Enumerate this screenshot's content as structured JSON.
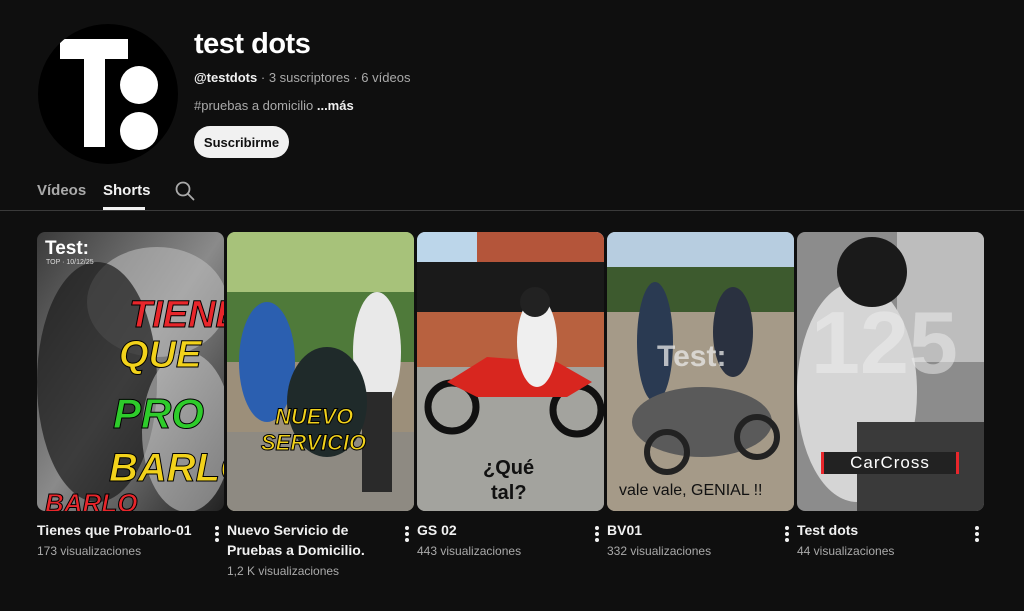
{
  "channel": {
    "name": "test dots",
    "handle": "@testdots",
    "separator": " · ",
    "subscribers": "3 suscriptores",
    "videos": "6 vídeos",
    "description": "#pruebas a domicilio",
    "more": " ...más",
    "subscribe_label": "Suscribirme"
  },
  "tabs": {
    "videos": "Vídeos",
    "shorts": "Shorts",
    "search_icon": "search-icon"
  },
  "shorts": [
    {
      "title": "Tienes que Probarlo-01",
      "views": "173 visualizaciones",
      "overlay": {
        "brand": "Test:",
        "brand_sub": "TOP · 10/12/25",
        "line1": "TIENES",
        "line2": "QUE",
        "line3": "PRO",
        "line4": "BARLO"
      }
    },
    {
      "title": "Nuevo Servicio de Pruebas a Domicilio.",
      "views": "1,2 K visualizaciones",
      "overlay": {
        "line1": "NUEVO",
        "line2": "SERVICIO"
      }
    },
    {
      "title": "GS 02",
      "views": "443 visualizaciones",
      "overlay": {
        "line1": "¿Qué",
        "line2": "tal?"
      }
    },
    {
      "title": "BV01",
      "views": "332 visualizaciones",
      "overlay": {
        "brand": "Test:",
        "line1": "vale vale, GENIAL !!"
      }
    },
    {
      "title": "Test dots",
      "views": "44 visualizaciones",
      "overlay": {
        "big": "125",
        "tag": "CarCross"
      }
    }
  ],
  "colors": {
    "background": "#0f0f0f",
    "text_primary": "#f1f1f1",
    "text_secondary": "#aaaaaa",
    "accent_red": "#e8262b",
    "accent_yellow": "#f2d21b",
    "accent_green": "#2ecc2b"
  }
}
